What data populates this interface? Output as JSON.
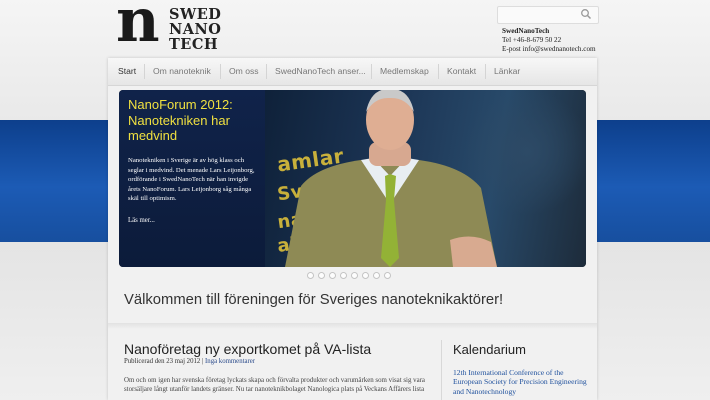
{
  "logo": {
    "letter": "n",
    "lines": [
      "SWED",
      "NANO",
      "TECH"
    ]
  },
  "search": {
    "placeholder": ""
  },
  "contact": {
    "name": "SwedNanoTech",
    "tel": "Tel +46-8-679 50 22",
    "email": "E-post info@swednanotech.com"
  },
  "nav": {
    "items": [
      "Start",
      "Om nanoteknik",
      "Om oss",
      "SwedNanoTech anser...",
      "Medlemskap",
      "Kontakt",
      "Länkar"
    ]
  },
  "slide": {
    "title": "NanoForum 2012: Nanotekniken har medvind",
    "text": "Nanotekniken i Sverige är av hög klass och seglar i medvind. Det menade Lars Leijonborg, ordförande i SwedNanoTech när han invigde årets NanoForum. Lars Leijonborg såg många skäl till optimism.",
    "more": "Läs mer...",
    "photo_words": [
      "amlar",
      "Sveriges",
      "nanoteknik",
      "aktörer!"
    ]
  },
  "welcome": "Välkommen till föreningen för Sveriges nanoteknikaktörer!",
  "article": {
    "title": "Nanoföretag ny exportkomet på VA-lista",
    "meta_date": "Publicerad den 23 maj 2012 |",
    "meta_link": "Inga kommentarer",
    "body": "Om och om igen har svenska företag lyckats skapa och förvalta produkter och varumärken som visat sig vara storsäljare långt utanför landets gränser. Nu tar nanoteknikbolaget Nanologica plats på Veckans Affärers lista"
  },
  "calendar": {
    "title": "Kalendarium",
    "item": "12th International Conference of the European Society for Precision Engineering and Nanotechnology"
  },
  "colors": {
    "band": "#1c5bb5",
    "slide_title": "#f0e040",
    "calendar_link": "#1d4f9c"
  }
}
